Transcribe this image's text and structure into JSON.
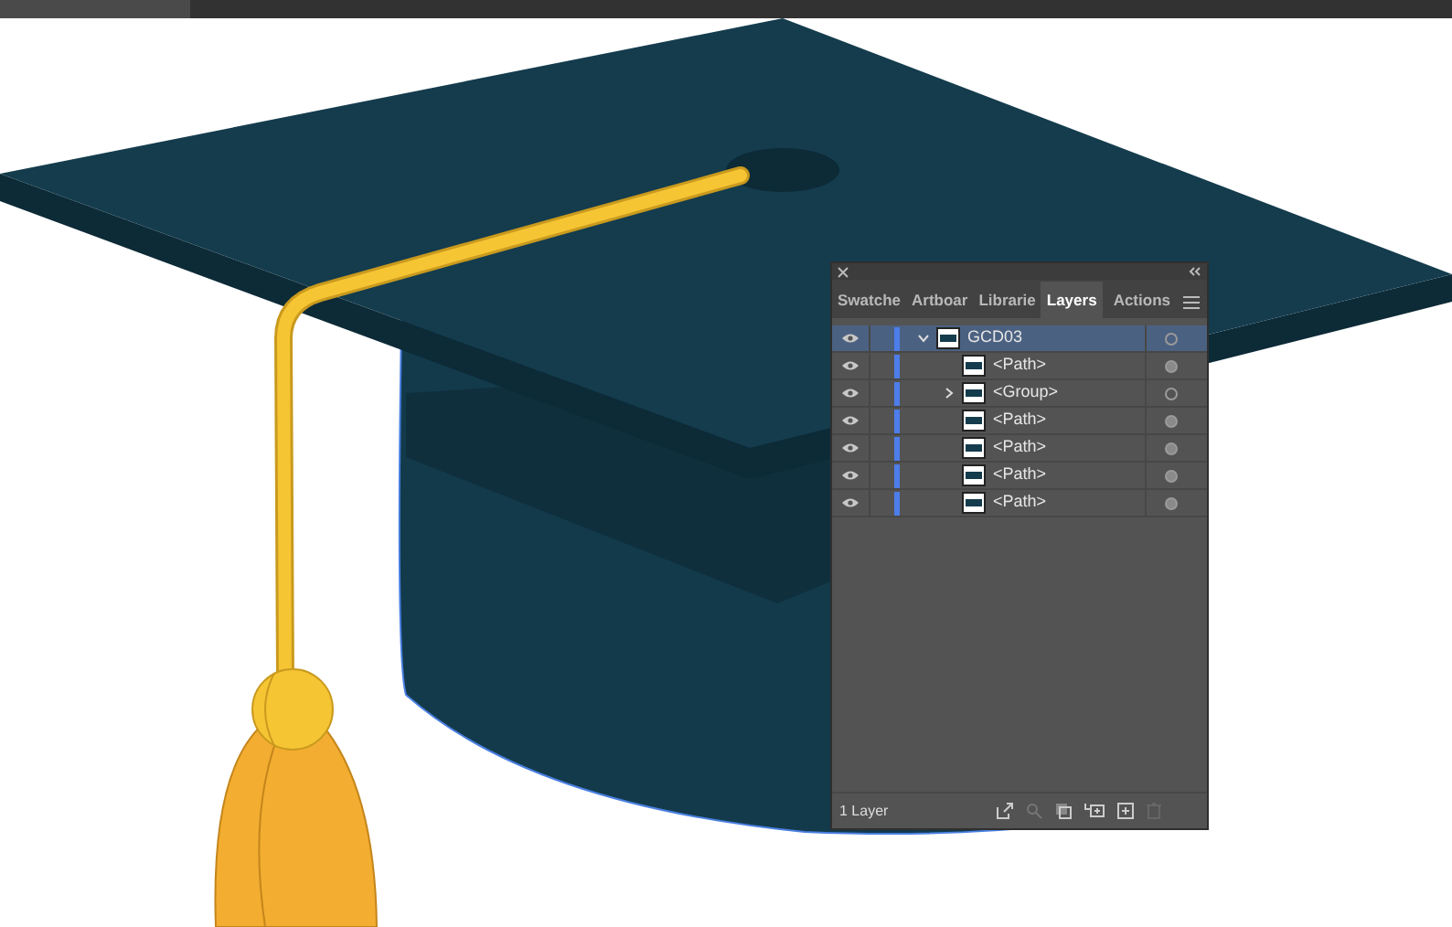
{
  "layers_panel": {
    "tabs": [
      {
        "label": "Swatche",
        "selected": false
      },
      {
        "label": "Artboar",
        "selected": false
      },
      {
        "label": "Librarie",
        "selected": false
      },
      {
        "label": "Layers",
        "selected": true
      },
      {
        "label": "Actions",
        "selected": false
      }
    ],
    "layers": [
      {
        "name": "GCD03",
        "visible": true,
        "selected": true,
        "expanded": true,
        "target_filled": false,
        "children": [
          {
            "name": "<Path>",
            "visible": true,
            "selected": false,
            "target_filled": true
          },
          {
            "name": "<Group>",
            "visible": true,
            "selected": false,
            "expanded": false,
            "target_filled": false
          },
          {
            "name": "<Path>",
            "visible": true,
            "selected": false,
            "target_filled": true
          },
          {
            "name": "<Path>",
            "visible": true,
            "selected": false,
            "target_filled": true
          },
          {
            "name": "<Path>",
            "visible": true,
            "selected": false,
            "target_filled": true
          },
          {
            "name": "<Path>",
            "visible": true,
            "selected": false,
            "target_filled": true
          }
        ]
      }
    ],
    "footer": "1 Layer"
  }
}
